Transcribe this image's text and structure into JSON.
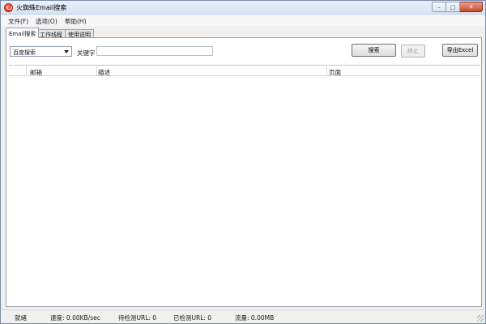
{
  "window": {
    "title": "火蜘蛛Email搜索",
    "controls": {
      "minimize": "–",
      "maximize": "□",
      "close": "✕"
    }
  },
  "menu": {
    "file": "文件(F)",
    "options": "选项(O)",
    "help": "帮助(H)"
  },
  "tabs": [
    {
      "label": "Email搜索",
      "active": true
    },
    {
      "label": "工作线程",
      "active": false
    },
    {
      "label": "使用说明",
      "active": false
    }
  ],
  "search": {
    "engine_selected": "百度搜索",
    "keyword_label": "关键字",
    "keyword_value": "",
    "search_button": "搜索",
    "stop_button": "终止",
    "export_button": "导出Excel"
  },
  "table": {
    "columns": [
      "邮箱",
      "描述",
      "页面"
    ],
    "rows": []
  },
  "status": {
    "state": "就绪",
    "speed": "速度: 0.00KB/sec",
    "pending": "待检测URL: 0",
    "checked": "已检测URL: 0",
    "traffic": "流量: 0.00MB"
  }
}
